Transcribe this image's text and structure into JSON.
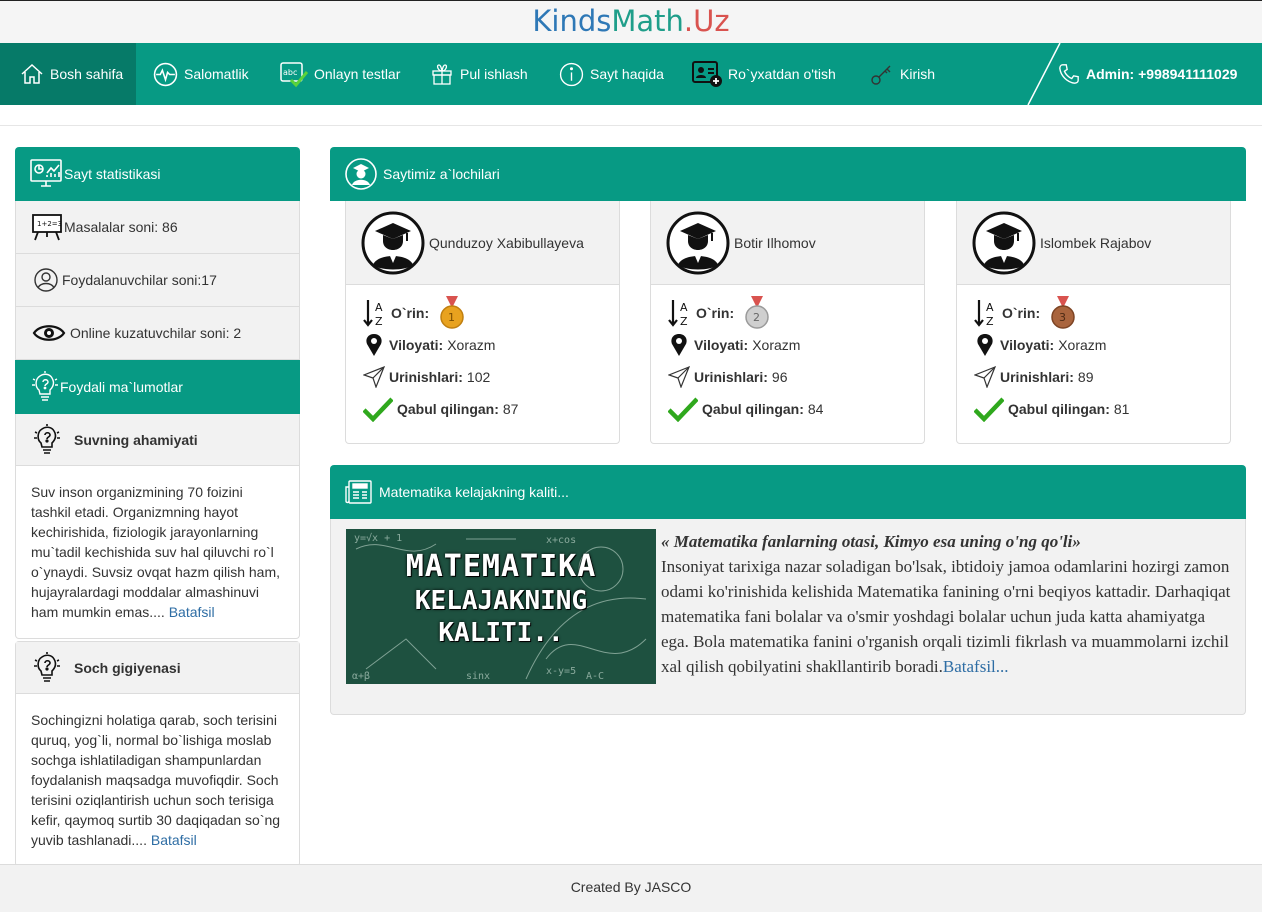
{
  "brand": {
    "part1": "Kinds",
    "part2": "Math",
    "part3": ".Uz"
  },
  "nav": {
    "items": [
      {
        "label": "Bosh sahifa"
      },
      {
        "label": "Salomatlik"
      },
      {
        "label": "Onlayn testlar"
      },
      {
        "label": "Pul ishlash"
      },
      {
        "label": "Sayt haqida"
      },
      {
        "label": "Ro`yxatdan o'tish"
      },
      {
        "label": "Kirish"
      }
    ],
    "admin": "Admin: +998941111029"
  },
  "stats": {
    "title": "Sayt statistikasi",
    "rows": [
      {
        "label": "Masalalar soni: 86"
      },
      {
        "label": "Foydalanuvchilar soni:17"
      },
      {
        "label": "Online kuzatuvchilar soni: 2"
      }
    ]
  },
  "info": {
    "title": "Foydali ma`lumotlar",
    "cards": [
      {
        "title": "Suvning ahamiyati",
        "text": "Suv inson organizmining 70 foizini tashkil etadi. Organizmning hayot kechirishida, fiziologik jarayonlarning mu`tadil kechishida suv hal qiluvchi ro`l o`ynaydi. Suvsiz ovqat hazm qilish ham, hujayralardagi moddalar almashinuvi ham mumkin emas....",
        "link": "Batafsil"
      },
      {
        "title": "Soch gigiyenasi",
        "text": "Sochingizni holatiga qarab, soch terisini quruq, yog`li, normal bo`lishiga moslab sochga ishlatiladigan shampunlardan foydalanish maqsadga muvofiqdir. Soch terisini oziqlantirish uchun soch terisiga kefir, qaymoq surtib 30 daqiqadan so`ng yuvib tashlanadi....",
        "link": "Batafsil"
      }
    ]
  },
  "leaders": {
    "title": "Saytimiz a`lochilari",
    "labels": {
      "place": "O`rin:",
      "region": "Viloyati:",
      "attempts": "Urinishlari:",
      "accepted": "Qabul qilingan:"
    },
    "students": [
      {
        "name": "Qunduzoy Xabibullayeva",
        "region": "Xorazm",
        "attempts": "102",
        "accepted": "87",
        "medal_color": "#e8a21f"
      },
      {
        "name": "Botir Ilhomov",
        "region": "Xorazm",
        "attempts": "96",
        "accepted": "84",
        "medal_color": "#bdbdbd"
      },
      {
        "name": "Islombek Rajabov",
        "region": "Xorazm",
        "attempts": "89",
        "accepted": "81",
        "medal_color": "#a9643d"
      }
    ]
  },
  "news": {
    "title": "Matematika kelajakning kaliti...",
    "image_lines": [
      "MATEMATIKA",
      "KELAJAKNING",
      "KALITI.."
    ],
    "quote": "« Matematika fanlarning otasi, Kimyo esa uning o'ng qo'li»",
    "text": "Insoniyat tarixiga nazar soladigan bo'lsak, ibtidoiy jamoa odamlarini hozirgi zamon odami ko'rinishida kelishida Matematika fanining o'rni beqiyos kattadir. Darhaqiqat matematika fani bolalar va o'smir yoshdagi bolalar uchun juda katta ahamiyatga ega. Bola matematika fanini o'rganish orqali tizimli fikrlash va muammolarni izchil xal qilish qobilyatini shakllantirib boradi.",
    "link": "Batafsil..."
  },
  "footer": "Created By JASCO"
}
